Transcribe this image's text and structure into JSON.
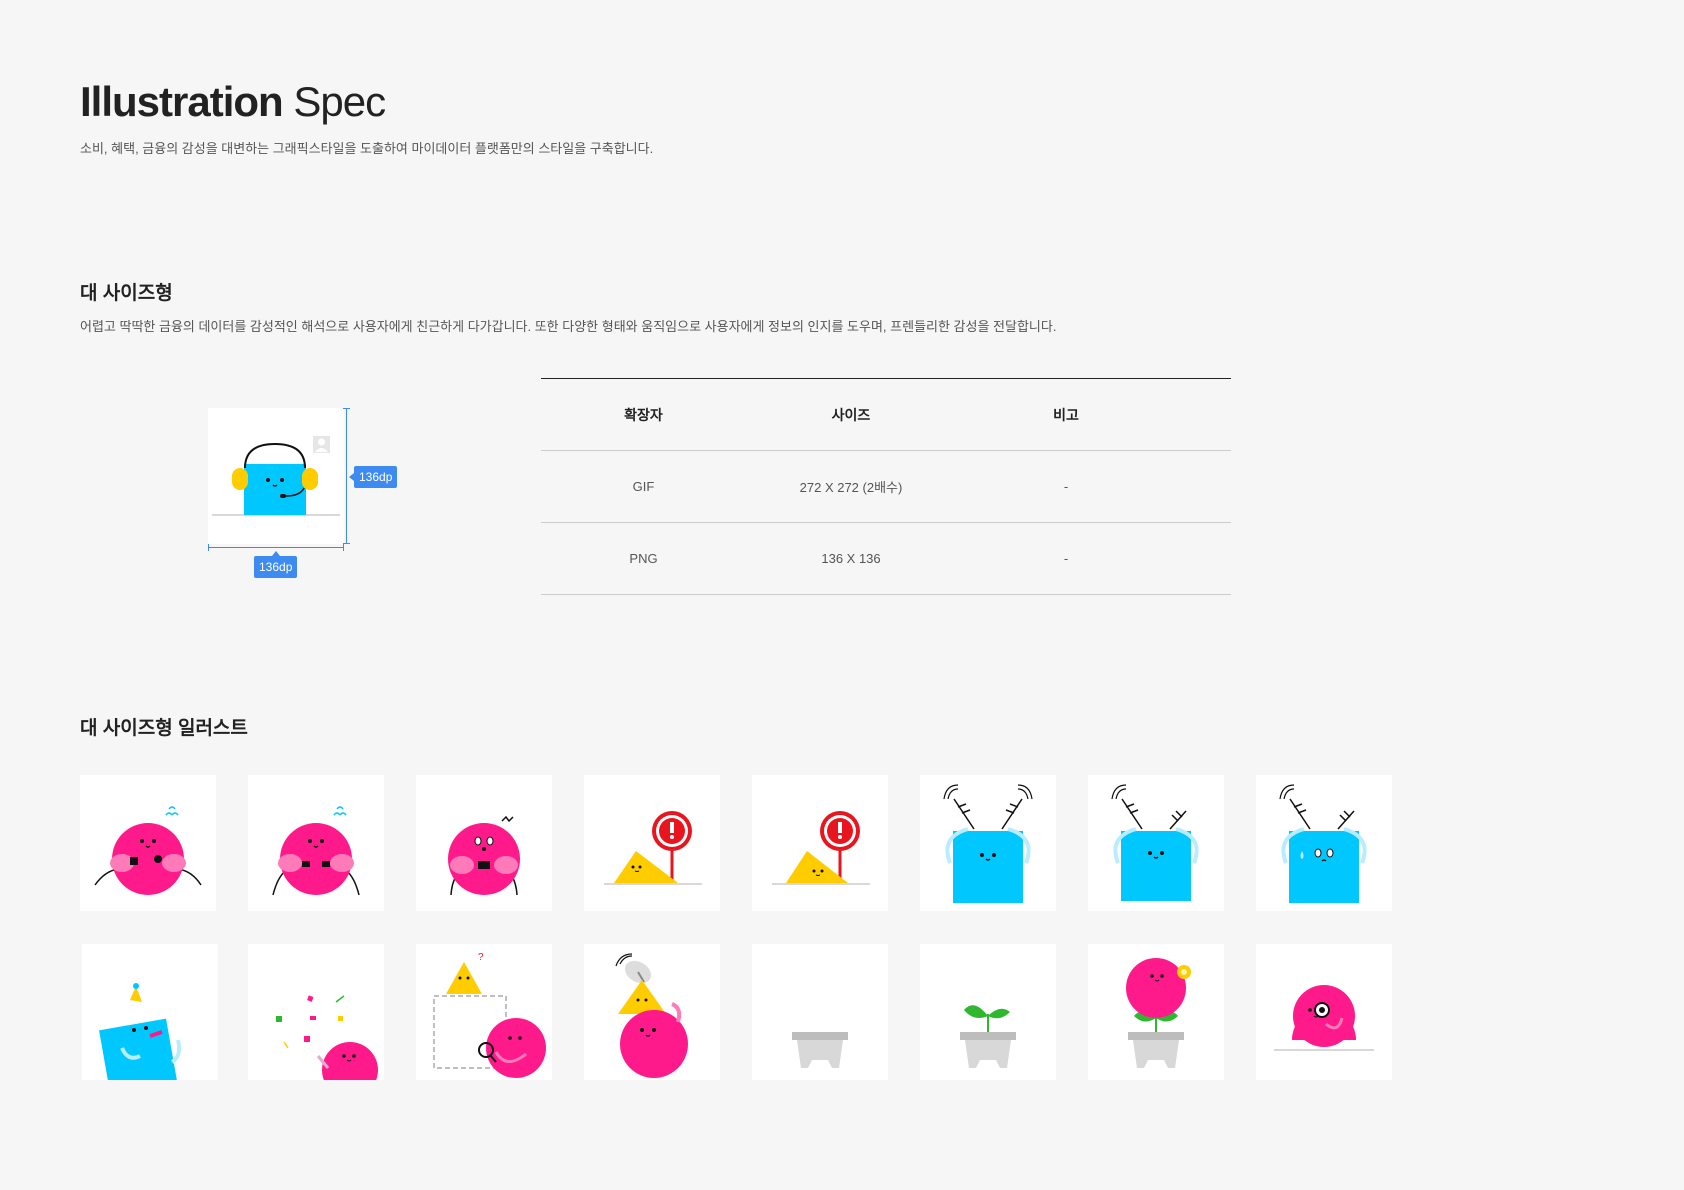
{
  "header": {
    "title_bold": "Illustration",
    "title_light": "Spec",
    "subtitle": "소비, 혜택, 금융의 감성을 대변하는 그래픽스타일을 도출하여 마이데이터 플랫폼만의 스타일을 구축합니다."
  },
  "large_size": {
    "title": "대 사이즈형",
    "description": "어렵고 딱딱한 금융의 데이터를 감성적인 해석으로 사용자에게 친근하게 다가갑니다. 또한 다양한 형태와 움직임으로 사용자에게 정보의 인지를 도우며, 프렌들리한 감성을 전달합니다.",
    "dim_width": "136dp",
    "dim_height": "136dp",
    "table": {
      "headers": [
        "확장자",
        "사이즈",
        "비고"
      ],
      "rows": [
        [
          "GIF",
          "272 X 272 (2배수)",
          "-"
        ],
        [
          "PNG",
          "136 X 136",
          "-"
        ]
      ]
    }
  },
  "illustrations": {
    "title": "대 사이즈형 일러스트",
    "colors": {
      "pink": "#ff1a8c",
      "blue": "#00c8ff",
      "yellow": "#ffcc00",
      "red": "#e8141e",
      "gray": "#c8c8c8",
      "green": "#2fb82f"
    },
    "row1": [
      "pink-circle-sweat-icon",
      "pink-circle-sweat-alt-icon",
      "pink-circle-startled-icon",
      "yellow-triangle-warning-icon",
      "yellow-triangle-warning-alt-icon",
      "blue-square-antenna-icon",
      "blue-square-antenna-alt-icon",
      "blue-square-antenna-sad-icon"
    ],
    "row2": [
      "blue-square-party-icon",
      "confetti-pink-circle-icon",
      "triangle-search-empty-icon",
      "satellite-triangle-circle-icon",
      "empty-pot-icon",
      "sprout-pot-icon",
      "flower-pot-icon",
      "pink-circle-monocle-icon"
    ]
  }
}
